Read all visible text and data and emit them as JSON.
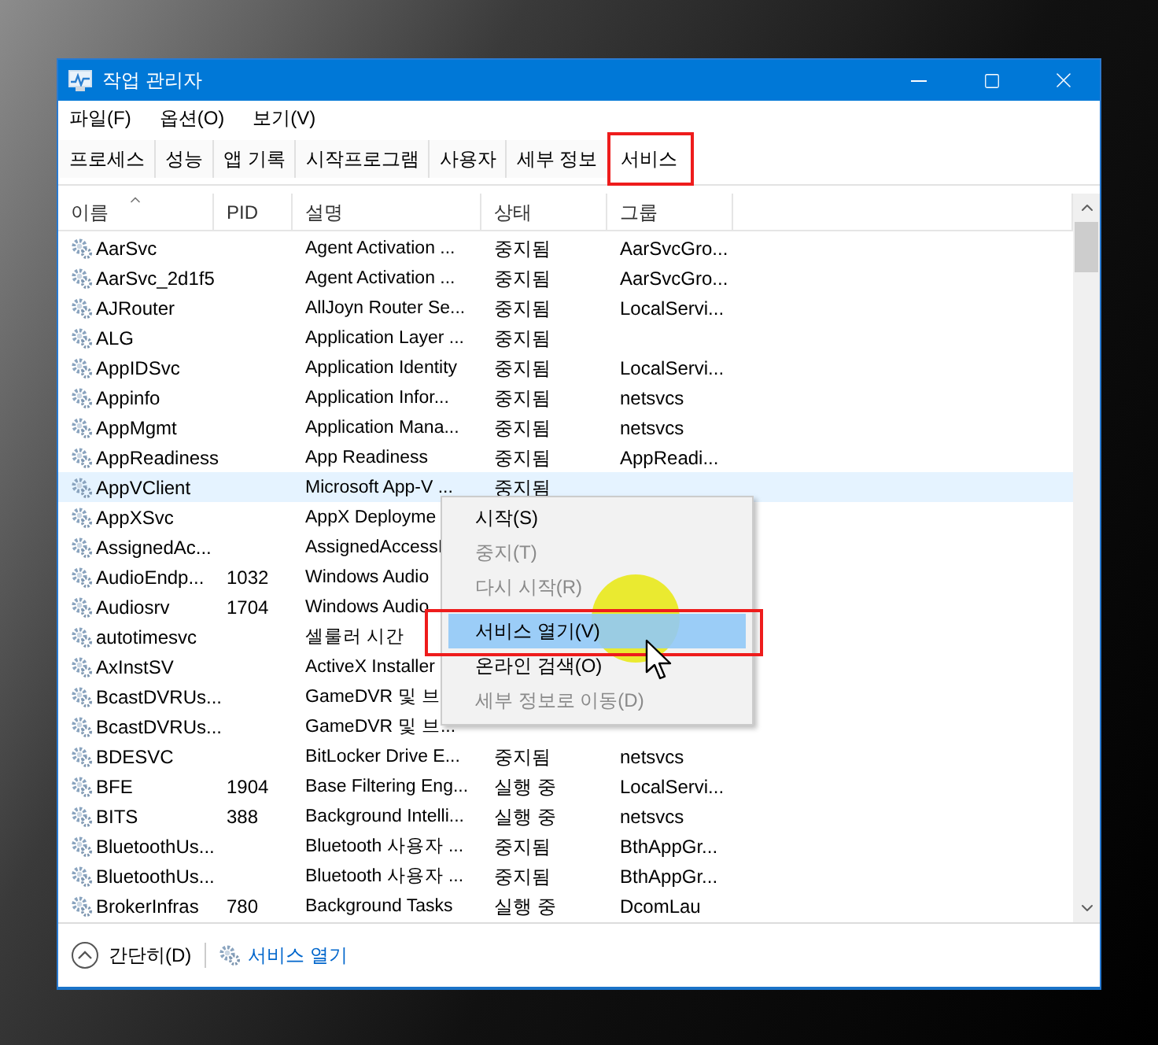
{
  "window": {
    "title": "작업 관리자"
  },
  "menu_bar": [
    "파일(F)",
    "옵션(O)",
    "보기(V)"
  ],
  "tabs": [
    {
      "label": "프로세스",
      "selected": false,
      "annotated": false
    },
    {
      "label": "성능",
      "selected": false,
      "annotated": false
    },
    {
      "label": "앱 기록",
      "selected": false,
      "annotated": false
    },
    {
      "label": "시작프로그램",
      "selected": false,
      "annotated": false
    },
    {
      "label": "사용자",
      "selected": false,
      "annotated": false
    },
    {
      "label": "세부 정보",
      "selected": false,
      "annotated": false
    },
    {
      "label": "서비스",
      "selected": true,
      "annotated": true
    }
  ],
  "table": {
    "columns": [
      "이름",
      "PID",
      "설명",
      "상태",
      "그룹"
    ],
    "rows": [
      {
        "name": "AarSvc",
        "description": "Agent Activation ...",
        "status": "중지됨",
        "group": "AarSvcGro...",
        "selected": false
      },
      {
        "name": "AarSvc_2d1f5",
        "description": "Agent Activation ...",
        "status": "중지됨",
        "group": "AarSvcGro...",
        "selected": false
      },
      {
        "name": "AJRouter",
        "description": "AllJoyn Router Se...",
        "status": "중지됨",
        "group": "LocalServi...",
        "selected": false
      },
      {
        "name": "ALG",
        "description": "Application Layer ...",
        "status": "중지됨",
        "selected": false
      },
      {
        "name": "AppIDSvc",
        "description": "Application Identity",
        "status": "중지됨",
        "group": "LocalServi...",
        "selected": false
      },
      {
        "name": "Appinfo",
        "description": "Application Infor...",
        "status": "중지됨",
        "group": "netsvcs",
        "selected": false
      },
      {
        "name": "AppMgmt",
        "description": "Application Mana...",
        "status": "중지됨",
        "group": "netsvcs",
        "selected": false
      },
      {
        "name": "AppReadiness",
        "description": "App Readiness",
        "status": "중지됨",
        "group": "AppReadi...",
        "selected": false
      },
      {
        "name": "AppVClient",
        "description": "Microsoft App-V ...",
        "status": "중지됨",
        "selected": true
      },
      {
        "name": "AppXSvc",
        "description": "AppX Deployme",
        "selected": false
      },
      {
        "name": "AssignedAc...",
        "description": "AssignedAccessI",
        "selected": false
      },
      {
        "name": "AudioEndp...",
        "pid": "1032",
        "description": "Windows Audio",
        "selected": false
      },
      {
        "name": "Audiosrv",
        "pid": "1704",
        "description": "Windows Audio",
        "selected": false
      },
      {
        "name": "autotimesvc",
        "description": "셀룰러 시간",
        "selected": false
      },
      {
        "name": "AxInstSV",
        "description": "ActiveX Installer",
        "selected": false
      },
      {
        "name": "BcastDVRUs...",
        "description": "GameDVR 및 브",
        "selected": false
      },
      {
        "name": "BcastDVRUs...",
        "description": "GameDVR 및 브...",
        "selected": false
      },
      {
        "name": "BDESVC",
        "description": "BitLocker Drive E...",
        "status": "중지됨",
        "group": "netsvcs",
        "selected": false
      },
      {
        "name": "BFE",
        "pid": "1904",
        "description": "Base Filtering Eng...",
        "status": "실행 중",
        "group": "LocalServi...",
        "selected": false
      },
      {
        "name": "BITS",
        "pid": "388",
        "description": "Background Intelli...",
        "status": "실행 중",
        "group": "netsvcs",
        "selected": false
      },
      {
        "name": "BluetoothUs...",
        "description": "Bluetooth 사용자 ...",
        "status": "중지됨",
        "group": "BthAppGr...",
        "selected": false
      },
      {
        "name": "BluetoothUs...",
        "description": "Bluetooth 사용자 ...",
        "status": "중지됨",
        "group": "BthAppGr...",
        "selected": false
      },
      {
        "name": "BrokerInfras",
        "pid": "780",
        "description": "Background Tasks",
        "status": "실행 중",
        "group": "DcomLau",
        "selected": false
      }
    ]
  },
  "context_menu": {
    "groups": [
      [
        {
          "label": "시작(S)",
          "disabled": false,
          "selected": false,
          "annotated": false
        },
        {
          "label": "중지(T)",
          "disabled": true,
          "selected": false,
          "annotated": false
        },
        {
          "label": "다시 시작(R)",
          "disabled": true,
          "selected": false,
          "annotated": false
        }
      ],
      [
        {
          "label": "서비스 열기(V)",
          "disabled": false,
          "selected": true,
          "annotated": true
        },
        {
          "label": "온라인 검색(O)",
          "disabled": false,
          "selected": false,
          "annotated": false
        },
        {
          "label": "세부 정보로 이동(D)",
          "disabled": true,
          "selected": false,
          "annotated": false
        }
      ]
    ]
  },
  "footer": {
    "collapse_label": "간단히(D)",
    "link": "서비스 열기"
  }
}
